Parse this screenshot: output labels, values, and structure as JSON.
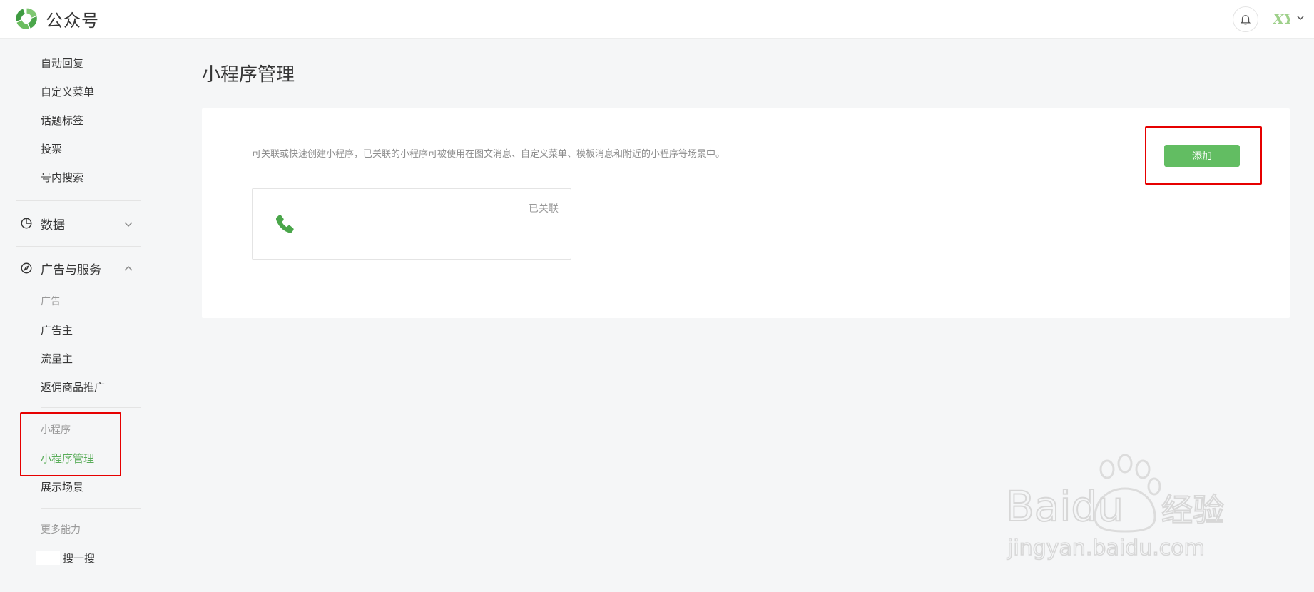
{
  "header": {
    "brand_name": "公众号",
    "avatar_text": "XY",
    "bell_icon": "bell-icon",
    "colors": {
      "brand_green": "#62bd62",
      "highlight_red": "#e60000"
    }
  },
  "sidebar": {
    "top_items": [
      {
        "label": "自动回复"
      },
      {
        "label": "自定义菜单"
      },
      {
        "label": "话题标签"
      },
      {
        "label": "投票"
      },
      {
        "label": "号内搜索"
      }
    ],
    "sections": [
      {
        "label": "数据",
        "icon": "pie-chart-icon",
        "expanded": false
      },
      {
        "label": "广告与服务",
        "icon": "compass-icon",
        "expanded": true
      }
    ],
    "ads_group": {
      "title": "广告",
      "items": [
        {
          "label": "广告主"
        },
        {
          "label": "流量主"
        },
        {
          "label": "返佣商品推广"
        }
      ]
    },
    "mini_group": {
      "title": "小程序",
      "items": [
        {
          "label": "小程序管理",
          "active": true
        },
        {
          "label": "展示场景"
        }
      ]
    },
    "more_group": {
      "title": "更多能力",
      "items": [
        {
          "label": "搜一搜"
        }
      ]
    }
  },
  "main": {
    "title": "小程序管理",
    "description": "可关联或快速创建小程序，已关联的小程序可被使用在图文消息、自定义菜单、模板消息和附近的小程序等场景中。",
    "add_button": "添加",
    "cards": [
      {
        "icon": "phone-icon",
        "status": "已关联"
      }
    ]
  },
  "watermark": {
    "brand": "Baidu",
    "suffix": "经验",
    "url": "jingyan.baidu.com"
  }
}
